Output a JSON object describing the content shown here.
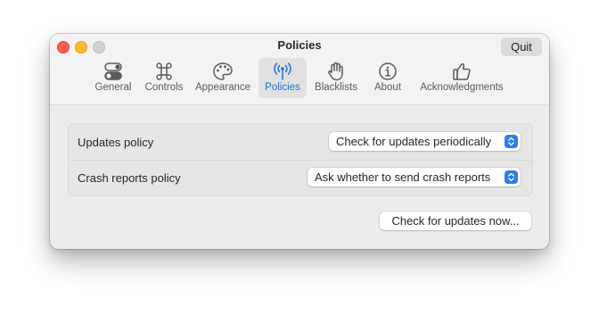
{
  "window": {
    "title": "Policies",
    "quit_label": "Quit"
  },
  "tabs": [
    {
      "label": "General",
      "icon": "toggles-icon"
    },
    {
      "label": "Controls",
      "icon": "command-icon"
    },
    {
      "label": "Appearance",
      "icon": "palette-icon"
    },
    {
      "label": "Policies",
      "icon": "antenna-icon",
      "selected": true
    },
    {
      "label": "Blacklists",
      "icon": "hand-raised-icon"
    },
    {
      "label": "About",
      "icon": "info-icon"
    },
    {
      "label": "Acknowledgments",
      "icon": "thumbs-up-icon"
    }
  ],
  "settings": {
    "updates_policy": {
      "label": "Updates policy",
      "value": "Check for updates periodically"
    },
    "crash_reports_policy": {
      "label": "Crash reports policy",
      "value": "Ask whether to send crash reports"
    }
  },
  "actions": {
    "check_updates_label": "Check for updates now..."
  },
  "colors": {
    "accent": "#1f6fd6",
    "popup_chevron": "#2c7cf6",
    "close": "#ff5f57",
    "minimize": "#febc2e",
    "zoom": "#d1d1d1"
  }
}
